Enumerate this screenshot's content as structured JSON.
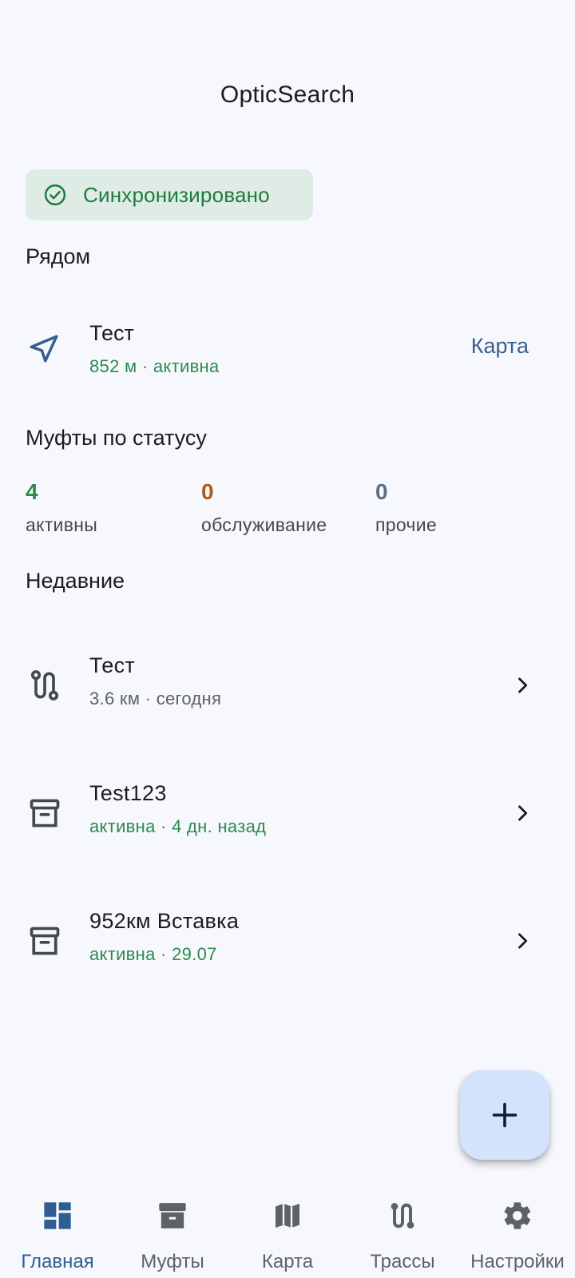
{
  "app": {
    "title": "OpticSearch"
  },
  "sync": {
    "label": "Синхронизировано",
    "icon": "check-circle-icon",
    "color": "#1e7b3f"
  },
  "nearby": {
    "heading": "Рядом",
    "item": {
      "name": "Тест",
      "subtitle": "852 м · активна",
      "icon": "navigation-arrow-icon"
    },
    "map_link": "Карта"
  },
  "status": {
    "heading": "Муфты по статусу",
    "stats": [
      {
        "value": "4",
        "label": "активны",
        "color": "#2c8a4b"
      },
      {
        "value": "0",
        "label": "обслуживание",
        "color": "#b05a1a"
      },
      {
        "value": "0",
        "label": "прочие",
        "color": "#5a6e86"
      }
    ]
  },
  "recent": {
    "heading": "Недавние",
    "items": [
      {
        "name": "Тест",
        "subtitle": "3.6 км · сегодня",
        "icon": "route-icon",
        "subtitle_color": "#5d6168"
      },
      {
        "name": "Test123",
        "subtitle": "активна · 4 дн. назад",
        "icon": "archive-box-icon",
        "subtitle_color": "#2c8a4b"
      },
      {
        "name": "952км Вставка",
        "subtitle": "активна · 29.07",
        "icon": "archive-box-icon",
        "subtitle_color": "#2c8a4b"
      }
    ]
  },
  "fab": {
    "icon": "plus-icon"
  },
  "nav": {
    "items": [
      {
        "label": "Главная",
        "icon": "dashboard-icon",
        "active": true
      },
      {
        "label": "Муфты",
        "icon": "archive-box-icon",
        "active": false
      },
      {
        "label": "Карта",
        "icon": "map-icon",
        "active": false
      },
      {
        "label": "Трассы",
        "icon": "route-icon",
        "active": false
      },
      {
        "label": "Настройки",
        "icon": "gear-icon",
        "active": false
      }
    ],
    "active_color": "#2f5e93",
    "inactive_color": "#5d6168"
  }
}
